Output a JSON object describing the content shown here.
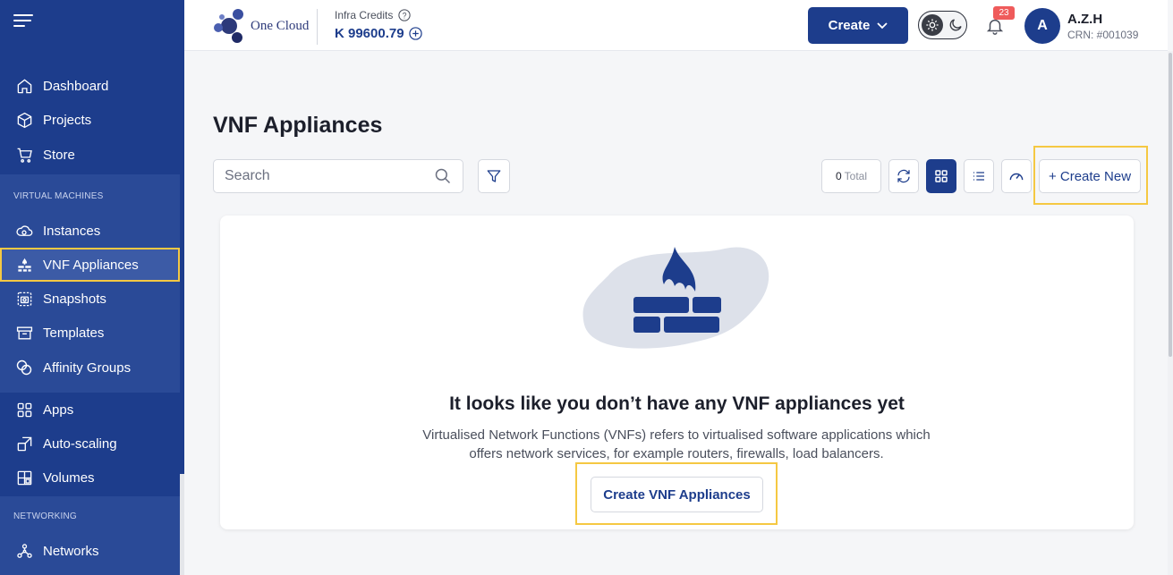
{
  "sidebar": {
    "primary": [
      {
        "label": "Dashboard",
        "icon": "home-icon"
      },
      {
        "label": "Projects",
        "icon": "cube-icon"
      },
      {
        "label": "Store",
        "icon": "cart-icon"
      }
    ],
    "sections": [
      {
        "label": "VIRTUAL MACHINES"
      },
      {
        "label": "NETWORKING"
      }
    ],
    "vm_items": [
      {
        "label": "Instances",
        "icon": "cloud-icon"
      },
      {
        "label": "VNF Appliances",
        "icon": "firewall-icon",
        "active": true
      },
      {
        "label": "Snapshots",
        "icon": "snapshot-icon"
      },
      {
        "label": "Templates",
        "icon": "archive-icon"
      },
      {
        "label": "Affinity Groups",
        "icon": "affinity-icon"
      }
    ],
    "other_items": [
      {
        "label": "Apps",
        "icon": "apps-grid-icon"
      },
      {
        "label": "Auto-scaling",
        "icon": "auto-scale-icon"
      },
      {
        "label": "Volumes",
        "icon": "volumes-icon"
      }
    ],
    "net_items": [
      {
        "label": "Networks",
        "icon": "network-icon"
      }
    ]
  },
  "header": {
    "logo_text": "One Cloud",
    "credits_label": "Infra Credits",
    "credits_value": "K 99600.79",
    "create_label": "Create",
    "notifications_count": "23",
    "avatar_letter": "A",
    "user_name": "A.Z.H",
    "user_crn": "CRN: #001039"
  },
  "main": {
    "title": "VNF Appliances",
    "search_placeholder": "Search",
    "total_count": "0",
    "total_label": "Total",
    "create_new_label": "+ Create New",
    "empty_title": "It looks like you don’t have any VNF appliances yet",
    "empty_desc_line1": "Virtualised Network Functions (VNFs) refers to virtualised software applications which",
    "empty_desc_line2": "offers network services, for example routers, firewalls, load balancers.",
    "cta_label": "Create VNF Appliances"
  },
  "colors": {
    "primary": "#1d3d8c",
    "highlight": "#f5c842",
    "badge": "#ef5b5b"
  }
}
